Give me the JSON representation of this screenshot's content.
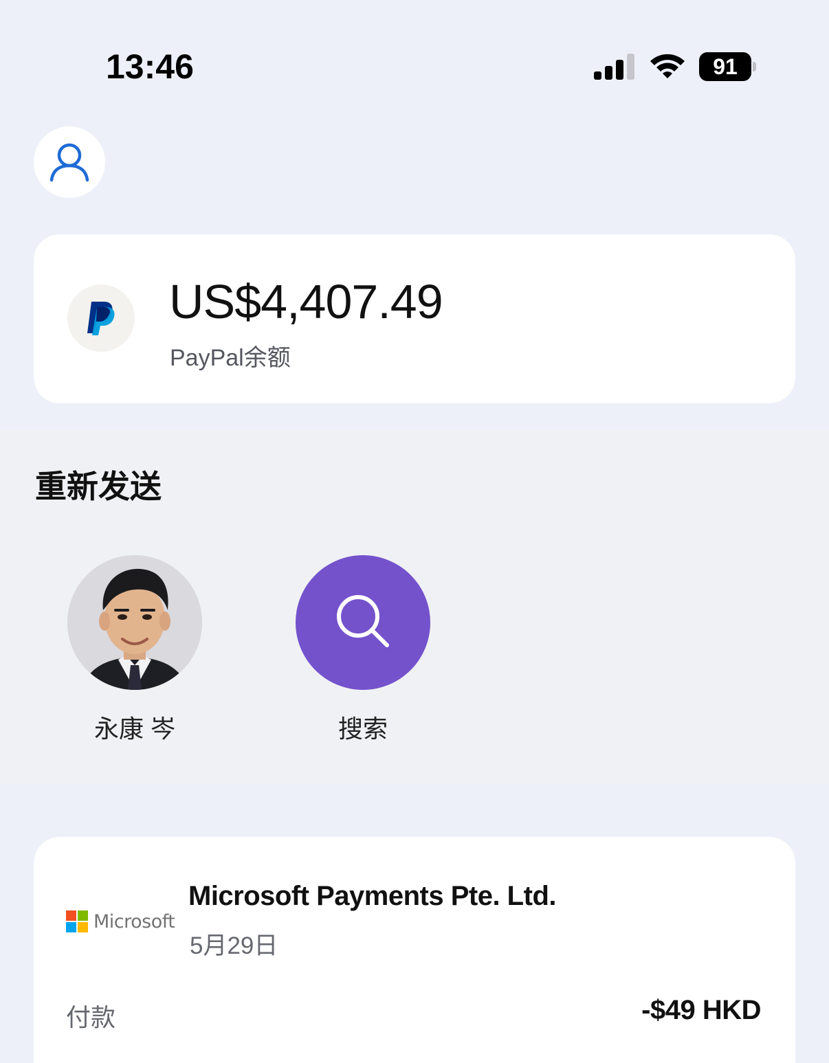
{
  "status_bar": {
    "time": "13:46",
    "battery": "91",
    "icons": [
      "cellular-signal-icon",
      "wifi-icon",
      "battery-icon"
    ]
  },
  "header": {
    "profile_icon": "user-icon"
  },
  "balance": {
    "amount": "US$4,407.49",
    "label": "PayPal余额",
    "logo": "paypal-logo"
  },
  "resend": {
    "title": "重新发送",
    "contacts": [
      {
        "name": "永康 岑",
        "avatar": "person-photo"
      },
      {
        "name": "搜索",
        "icon": "search-icon"
      }
    ]
  },
  "activity": {
    "merchant_logo_text": "Microsoft",
    "merchant_name": "Microsoft Payments Pte. Ltd.",
    "date": "5月29日",
    "type": "付款",
    "amount": "-$49 HKD"
  },
  "colors": {
    "page_background": "#eef0f9",
    "section_background": "#f0f1f4",
    "search_purple": "#7452cc",
    "profile_blue": "#1f6bd6",
    "paypal_dark_blue": "#003087",
    "paypal_light_blue": "#009cde"
  }
}
